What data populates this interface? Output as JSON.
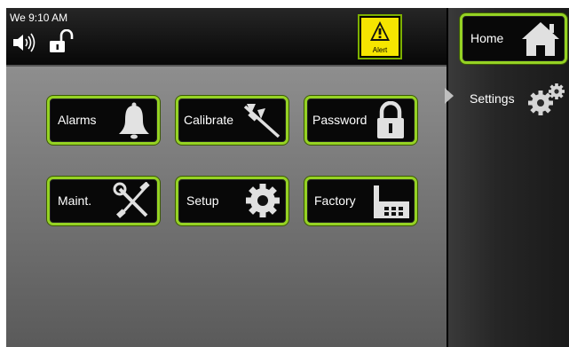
{
  "status": {
    "clock": "We 9:10 AM",
    "alert_label": "Alert"
  },
  "buttons": {
    "alarms": "Alarms",
    "calibrate": "Calibrate",
    "password": "Password",
    "maint": "Maint.",
    "setup": "Setup",
    "factory": "Factory"
  },
  "sidebar": {
    "home": "Home",
    "settings": "Settings"
  },
  "colors": {
    "accent_border": "#95d224",
    "alert_yellow": "#f6e500",
    "button_bg": "#080808"
  },
  "icons": [
    "speaker-icon",
    "unlocked-icon",
    "alert-triangle-icon",
    "bell-icon",
    "caliper-icon",
    "padlock-icon",
    "wrench-screwdriver-icon",
    "gear-icon",
    "factory-icon",
    "house-icon",
    "gears-icon"
  ]
}
